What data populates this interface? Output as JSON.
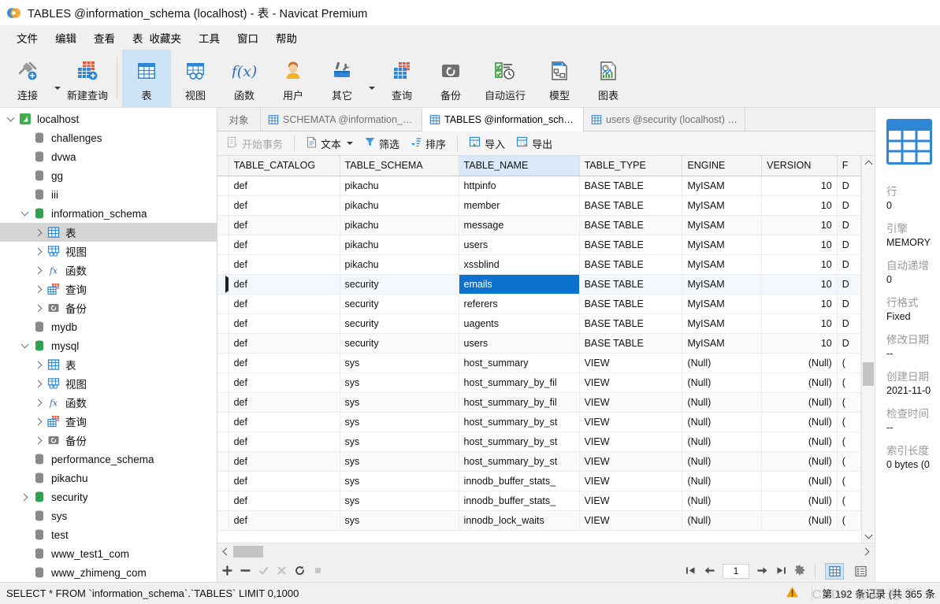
{
  "window": {
    "title": "TABLES @information_schema (localhost) - 表 - Navicat Premium",
    "logo": "navicat-logo-icon"
  },
  "menubar": {
    "items": [
      {
        "label": "文件",
        "name": "menu-file"
      },
      {
        "label": "编辑",
        "name": "menu-edit"
      },
      {
        "label": "查看",
        "name": "menu-view"
      },
      {
        "label": "表",
        "name": "menu-table"
      },
      {
        "label": "收藏夹",
        "name": "menu-favorites"
      },
      {
        "label": "工具",
        "name": "menu-tools"
      },
      {
        "label": "窗口",
        "name": "menu-window"
      },
      {
        "label": "帮助",
        "name": "menu-help"
      }
    ]
  },
  "toolbar": {
    "buttons": [
      {
        "label": "连接",
        "icon": "connection-icon",
        "name": "toolbar-connection",
        "caret": true,
        "active": false
      },
      {
        "label": "新建查询",
        "icon": "new-query-icon",
        "name": "toolbar-new-query",
        "caret": false,
        "active": false
      },
      {
        "label": "表",
        "icon": "table-icon",
        "name": "toolbar-table",
        "caret": false,
        "active": true
      },
      {
        "label": "视图",
        "icon": "view-icon",
        "name": "toolbar-view",
        "caret": false,
        "active": false
      },
      {
        "label": "函数",
        "icon": "function-fx-icon",
        "name": "toolbar-function",
        "caret": false,
        "active": false
      },
      {
        "label": "用户",
        "icon": "user-icon",
        "name": "toolbar-user",
        "caret": false,
        "active": false
      },
      {
        "label": "其它",
        "icon": "other-tools-icon",
        "name": "toolbar-other",
        "caret": true,
        "active": false
      },
      {
        "label": "查询",
        "icon": "query-icon",
        "name": "toolbar-query",
        "caret": false,
        "active": false
      },
      {
        "label": "备份",
        "icon": "backup-icon",
        "name": "toolbar-backup",
        "caret": false,
        "active": false
      },
      {
        "label": "自动运行",
        "icon": "automation-icon",
        "name": "toolbar-automation",
        "caret": false,
        "active": false
      },
      {
        "label": "模型",
        "icon": "model-icon",
        "name": "toolbar-model",
        "caret": false,
        "active": false
      },
      {
        "label": "图表",
        "icon": "chart-icon",
        "name": "toolbar-chart",
        "caret": false,
        "active": false
      }
    ]
  },
  "sidebar": {
    "nodes": [
      {
        "label": "localhost",
        "indent": 0,
        "twisty": "down",
        "icon": "connection-green-icon",
        "selected": false
      },
      {
        "label": "challenges",
        "indent": 1,
        "twisty": "none",
        "icon": "database-gray-icon",
        "selected": false
      },
      {
        "label": "dvwa",
        "indent": 1,
        "twisty": "none",
        "icon": "database-gray-icon",
        "selected": false
      },
      {
        "label": "gg",
        "indent": 1,
        "twisty": "none",
        "icon": "database-gray-icon",
        "selected": false
      },
      {
        "label": "iii",
        "indent": 1,
        "twisty": "none",
        "icon": "database-gray-icon",
        "selected": false
      },
      {
        "label": "information_schema",
        "indent": 1,
        "twisty": "down",
        "icon": "database-green-icon",
        "selected": false
      },
      {
        "label": "表",
        "indent": 2,
        "twisty": "right",
        "icon": "table-blue-icon",
        "selected": true
      },
      {
        "label": "视图",
        "indent": 2,
        "twisty": "right",
        "icon": "view-blue-icon",
        "selected": false
      },
      {
        "label": "函数",
        "indent": 2,
        "twisty": "right",
        "icon": "function-fx-icon",
        "selected": false
      },
      {
        "label": "查询",
        "indent": 2,
        "twisty": "right",
        "icon": "query-red-icon",
        "selected": false
      },
      {
        "label": "备份",
        "indent": 2,
        "twisty": "right",
        "icon": "backup-gray-icon",
        "selected": false
      },
      {
        "label": "mydb",
        "indent": 1,
        "twisty": "none",
        "icon": "database-gray-icon",
        "selected": false
      },
      {
        "label": "mysql",
        "indent": 1,
        "twisty": "down",
        "icon": "database-green-icon",
        "selected": false
      },
      {
        "label": "表",
        "indent": 2,
        "twisty": "right",
        "icon": "table-blue-icon",
        "selected": false
      },
      {
        "label": "视图",
        "indent": 2,
        "twisty": "right",
        "icon": "view-blue-icon",
        "selected": false
      },
      {
        "label": "函数",
        "indent": 2,
        "twisty": "right",
        "icon": "function-fx-icon",
        "selected": false
      },
      {
        "label": "查询",
        "indent": 2,
        "twisty": "right",
        "icon": "query-red-icon",
        "selected": false
      },
      {
        "label": "备份",
        "indent": 2,
        "twisty": "right",
        "icon": "backup-gray-icon",
        "selected": false
      },
      {
        "label": "performance_schema",
        "indent": 1,
        "twisty": "none",
        "icon": "database-gray-icon",
        "selected": false
      },
      {
        "label": "pikachu",
        "indent": 1,
        "twisty": "none",
        "icon": "database-gray-icon",
        "selected": false
      },
      {
        "label": "security",
        "indent": 1,
        "twisty": "right",
        "icon": "database-green-icon",
        "selected": false
      },
      {
        "label": "sys",
        "indent": 1,
        "twisty": "none",
        "icon": "database-gray-icon",
        "selected": false
      },
      {
        "label": "test",
        "indent": 1,
        "twisty": "none",
        "icon": "database-gray-icon",
        "selected": false
      },
      {
        "label": "www_test1_com",
        "indent": 1,
        "twisty": "none",
        "icon": "database-gray-icon",
        "selected": false
      },
      {
        "label": "www_zhimeng_com",
        "indent": 1,
        "twisty": "none",
        "icon": "database-gray-icon",
        "selected": false
      }
    ]
  },
  "tabs": [
    {
      "label": "对象",
      "icon": "none",
      "active": false,
      "name": "tab-objects"
    },
    {
      "label": "SCHEMATA @information_s...",
      "icon": "table-blue-icon",
      "active": false,
      "name": "tab-schemata"
    },
    {
      "label": "TABLES @information_sche...",
      "icon": "table-blue-icon",
      "active": true,
      "name": "tab-tables"
    },
    {
      "label": "users @security (localhost) -...",
      "icon": "table-blue-icon",
      "active": false,
      "name": "tab-users"
    }
  ],
  "gridbar": {
    "buttons": [
      {
        "label": "开始事务",
        "icon": "transaction-icon",
        "name": "begin-transaction-button",
        "disabled": true,
        "caret": false
      },
      {
        "label": "文本",
        "icon": "text-icon",
        "name": "text-button",
        "disabled": false,
        "caret": true
      },
      {
        "label": "筛选",
        "icon": "filter-icon",
        "name": "filter-button",
        "disabled": false,
        "caret": false
      },
      {
        "label": "排序",
        "icon": "sort-icon",
        "name": "sort-button",
        "disabled": false,
        "caret": false
      },
      {
        "label": "导入",
        "icon": "import-icon",
        "name": "import-button",
        "disabled": false,
        "caret": false
      },
      {
        "label": "导出",
        "icon": "export-icon",
        "name": "export-button",
        "disabled": false,
        "caret": false
      }
    ]
  },
  "grid": {
    "columns": [
      {
        "label": "TABLE_CATALOG",
        "width": 140,
        "selected": false
      },
      {
        "label": "TABLE_SCHEMA",
        "width": 150,
        "selected": false
      },
      {
        "label": "TABLE_NAME",
        "width": 152,
        "selected": true
      },
      {
        "label": "TABLE_TYPE",
        "width": 130,
        "selected": false
      },
      {
        "label": "ENGINE",
        "width": 100,
        "selected": false
      },
      {
        "label": "VERSION",
        "width": 95,
        "selected": false
      },
      {
        "label": "F",
        "width": 30,
        "selected": false
      }
    ],
    "selected_cell": {
      "row": 5,
      "column": 2
    },
    "rows": [
      {
        "marker": false,
        "cells": [
          "def",
          "pikachu",
          "httpinfo",
          "BASE TABLE",
          "MyISAM",
          "10",
          "D"
        ]
      },
      {
        "marker": false,
        "cells": [
          "def",
          "pikachu",
          "member",
          "BASE TABLE",
          "MyISAM",
          "10",
          "D"
        ]
      },
      {
        "marker": false,
        "cells": [
          "def",
          "pikachu",
          "message",
          "BASE TABLE",
          "MyISAM",
          "10",
          "D"
        ]
      },
      {
        "marker": false,
        "cells": [
          "def",
          "pikachu",
          "users",
          "BASE TABLE",
          "MyISAM",
          "10",
          "D"
        ]
      },
      {
        "marker": false,
        "cells": [
          "def",
          "pikachu",
          "xssblind",
          "BASE TABLE",
          "MyISAM",
          "10",
          "D"
        ]
      },
      {
        "marker": true,
        "cells": [
          "def",
          "security",
          "emails",
          "BASE TABLE",
          "MyISAM",
          "10",
          "D"
        ]
      },
      {
        "marker": false,
        "cells": [
          "def",
          "security",
          "referers",
          "BASE TABLE",
          "MyISAM",
          "10",
          "D"
        ]
      },
      {
        "marker": false,
        "cells": [
          "def",
          "security",
          "uagents",
          "BASE TABLE",
          "MyISAM",
          "10",
          "D"
        ]
      },
      {
        "marker": false,
        "cells": [
          "def",
          "security",
          "users",
          "BASE TABLE",
          "MyISAM",
          "10",
          "D"
        ]
      },
      {
        "marker": false,
        "cells": [
          "def",
          "sys",
          "host_summary",
          "VIEW",
          "(Null)",
          "(Null)",
          "("
        ]
      },
      {
        "marker": false,
        "cells": [
          "def",
          "sys",
          "host_summary_by_fil",
          "VIEW",
          "(Null)",
          "(Null)",
          "("
        ]
      },
      {
        "marker": false,
        "cells": [
          "def",
          "sys",
          "host_summary_by_fil",
          "VIEW",
          "(Null)",
          "(Null)",
          "("
        ]
      },
      {
        "marker": false,
        "cells": [
          "def",
          "sys",
          "host_summary_by_st",
          "VIEW",
          "(Null)",
          "(Null)",
          "("
        ]
      },
      {
        "marker": false,
        "cells": [
          "def",
          "sys",
          "host_summary_by_st",
          "VIEW",
          "(Null)",
          "(Null)",
          "("
        ]
      },
      {
        "marker": false,
        "cells": [
          "def",
          "sys",
          "host_summary_by_st",
          "VIEW",
          "(Null)",
          "(Null)",
          "("
        ]
      },
      {
        "marker": false,
        "cells": [
          "def",
          "sys",
          "innodb_buffer_stats_",
          "VIEW",
          "(Null)",
          "(Null)",
          "("
        ]
      },
      {
        "marker": false,
        "cells": [
          "def",
          "sys",
          "innodb_buffer_stats_",
          "VIEW",
          "(Null)",
          "(Null)",
          "("
        ]
      },
      {
        "marker": false,
        "cells": [
          "def",
          "sys",
          "innodb_lock_waits",
          "VIEW",
          "(Null)",
          "(Null)",
          "("
        ]
      }
    ]
  },
  "recordnav": {
    "edit_buttons": [
      {
        "icon": "plus-icon",
        "name": "add-record-button",
        "disabled": false
      },
      {
        "icon": "minus-icon",
        "name": "delete-record-button",
        "disabled": false
      },
      {
        "icon": "check-icon",
        "name": "apply-change-button",
        "disabled": true
      },
      {
        "icon": "cross-icon",
        "name": "cancel-change-button",
        "disabled": true
      },
      {
        "icon": "refresh-icon",
        "name": "refresh-button",
        "disabled": false
      },
      {
        "icon": "stop-icon",
        "name": "stop-button",
        "disabled": true
      }
    ],
    "page_value": "1",
    "nav_buttons": [
      {
        "icon": "first-page-icon",
        "name": "first-page-button"
      },
      {
        "icon": "prev-page-icon",
        "name": "prev-page-button"
      },
      {
        "icon": "next-page-icon",
        "name": "next-page-button"
      },
      {
        "icon": "last-page-icon",
        "name": "last-page-button"
      },
      {
        "icon": "gear-icon",
        "name": "grid-settings-button"
      }
    ],
    "view_modes": [
      {
        "icon": "grid-view-icon",
        "name": "grid-view-button",
        "active": true
      },
      {
        "icon": "form-view-icon",
        "name": "form-view-button",
        "active": false
      }
    ]
  },
  "infopanel": {
    "icon": "table-large-icon",
    "properties": [
      {
        "key": "行",
        "value": "0"
      },
      {
        "key": "引擎",
        "value": "MEMORY"
      },
      {
        "key": "自动递增",
        "value": "0"
      },
      {
        "key": "行格式",
        "value": "Fixed"
      },
      {
        "key": "修改日期",
        "value": "--"
      },
      {
        "key": "创建日期",
        "value": "2021-11-0"
      },
      {
        "key": "检查时间",
        "value": "--"
      },
      {
        "key": "索引长度",
        "value": "0 bytes (0"
      }
    ]
  },
  "statusbar": {
    "sql": "SELECT * FROM `information_schema`.`TABLES` LIMIT 0,1000",
    "warning_icon": "warning-triangle-icon",
    "record_count": "第 192 条记录 (共 365 条",
    "watermark": "CSDN @高 光 于..."
  },
  "colors": {
    "accent_blue": "#0b72cf",
    "toolbar_active": "#cde3f7",
    "header_selected": "#d9e9f7",
    "tree_selected": "#d5d5d5",
    "green_db": "#2fa14f",
    "warning": "#f0a500"
  }
}
